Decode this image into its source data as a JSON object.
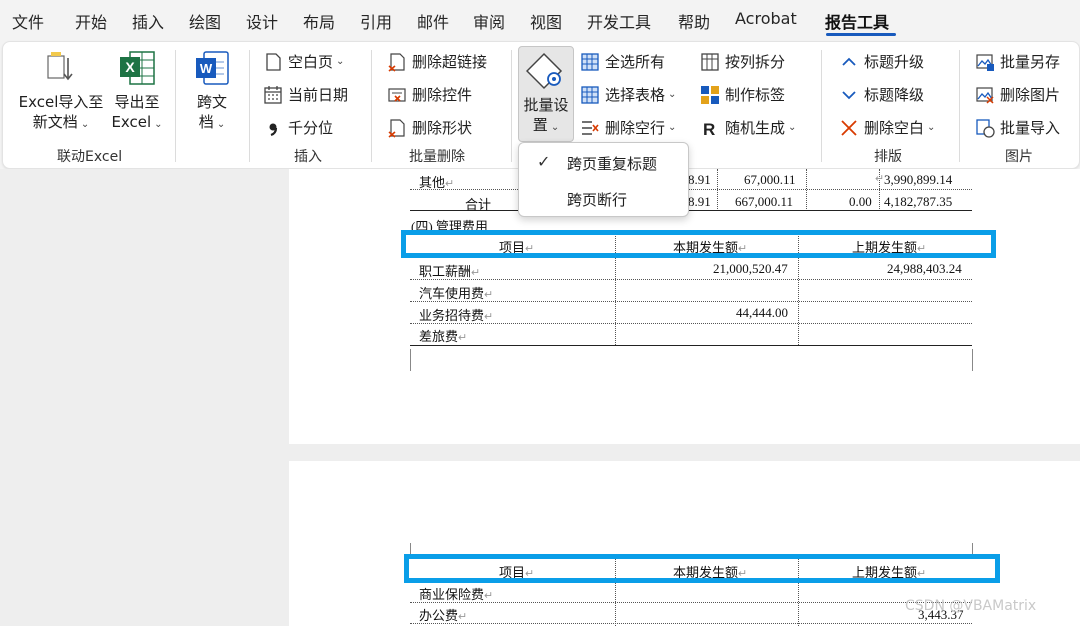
{
  "tabs": [
    "文件",
    "开始",
    "插入",
    "绘图",
    "设计",
    "布局",
    "引用",
    "邮件",
    "审阅",
    "视图",
    "开发工具",
    "帮助",
    "Acrobat",
    "报告工具"
  ],
  "active_tab": "报告工具",
  "ribbon": {
    "excel_group": {
      "label": "联动Excel",
      "import_label_1": "Excel导入至",
      "import_label_2": "新文档",
      "export_label_1": "导出至",
      "export_label_2": "Excel"
    },
    "cross_doc": {
      "label_1": "跨文",
      "label_2": "档"
    },
    "insert_group": {
      "label": "插入",
      "blank_page": "空白页",
      "current_date": "当前日期",
      "thousands": "千分位"
    },
    "delete_group": {
      "label": "批量删除",
      "del_hyperlink": "删除超链接",
      "del_control": "删除控件",
      "del_shape": "删除形状"
    },
    "batch_settings": {
      "label_1": "批量设",
      "label_2": "置"
    },
    "table_tools": {
      "select_all": "全选所有",
      "select_table": "选择表格",
      "del_empty_row": "删除空行",
      "split_col": "按列拆分",
      "make_label": "制作标签",
      "random_gen": "随机生成"
    },
    "layout_group": {
      "label": "排版",
      "heading_up": "标题升级",
      "heading_down": "标题降级",
      "del_blank": "删除空白"
    },
    "image_group": {
      "label": "图片",
      "save_as": "批量另存",
      "del_image": "删除图片",
      "import": "批量导入"
    }
  },
  "dropdown": {
    "item1": "跨页重复标题",
    "item2": "跨页断行",
    "item1_checked": true
  },
  "page1": {
    "row_other": {
      "label": "其他",
      "c1": "8.91",
      "c2": "67,000.11",
      "c3": "",
      "c4": "3,990,899.14"
    },
    "row_total": {
      "label": "合计",
      "c1": "8.91",
      "c2": "667,000.11",
      "c3": "0.00",
      "c4": "4,182,787.35"
    },
    "section_title": "(四) 管理费用",
    "header": {
      "col1": "项目",
      "col2": "本期发生额",
      "col3": "上期发生额"
    },
    "rows": [
      {
        "label": "职工薪酬",
        "cur": "21,000,520.47",
        "prev": "24,988,403.24"
      },
      {
        "label": "汽车使用费",
        "cur": "",
        "prev": ""
      },
      {
        "label": "业务招待费",
        "cur": "44,444.00",
        "prev": ""
      },
      {
        "label": "差旅费",
        "cur": "",
        "prev": ""
      }
    ]
  },
  "page2": {
    "header": {
      "col1": "项目",
      "col2": "本期发生额",
      "col3": "上期发生额"
    },
    "rows": [
      {
        "label": "商业保险费",
        "cur": "",
        "prev": ""
      },
      {
        "label": "办公费",
        "cur": "",
        "prev": "3,443.37"
      }
    ]
  },
  "watermark": "CSDN @VBAMatrix",
  "colors": {
    "highlight": "#0a9ee8",
    "accent": "#185abd",
    "excel_green": "#1d7344",
    "word_blue": "#185abd"
  }
}
